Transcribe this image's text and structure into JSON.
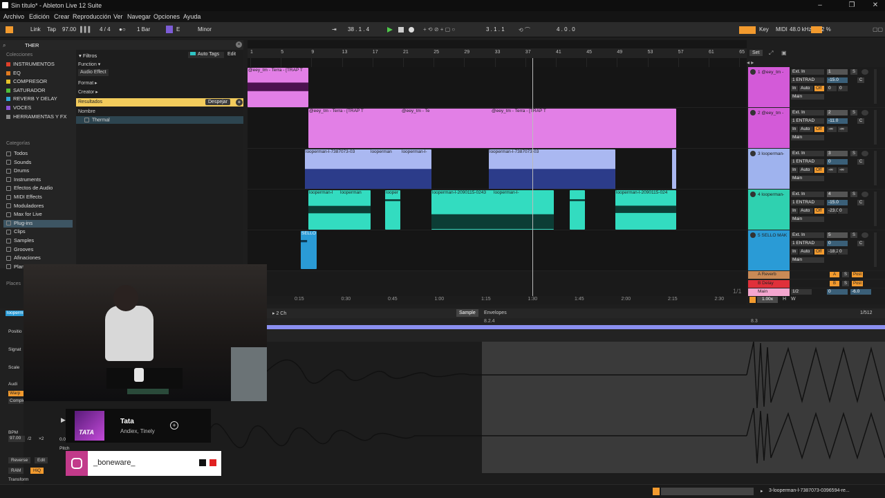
{
  "window": {
    "title": "Sin título* - Ableton Live 12 Suite"
  },
  "menu": [
    "Archivo",
    "Edición",
    "Crear",
    "Reproducción",
    "Ver",
    "Navegar",
    "Opciones",
    "Ayuda"
  ],
  "transport": {
    "link": "Link",
    "tap": "Tap",
    "tempo": "97.00",
    "signature": "4 / 4",
    "quantize": "1 Bar",
    "key": "E",
    "scale": "Minor",
    "position": "38 . 1 . 4",
    "loop_start": "3 . 1 . 1",
    "loop_length": "4 . 0 . 0",
    "key_btn": "Key",
    "midi_btn": "MIDI",
    "sample_rate": "48.0 kHz",
    "cpu": "2 %"
  },
  "browser": {
    "search": "THER",
    "filters_label": "Filtros",
    "auto_tags": "Auto Tags",
    "edit": "Edit",
    "function_label": "Function",
    "function_value": "Audio Effect",
    "format_label": "Format",
    "creator_label": "Creator",
    "results_label": "Resultados",
    "clear_btn": "Despejar",
    "name_col": "Nombre",
    "result_item": "Thermal",
    "collections_header": "Colecciones",
    "collections": [
      {
        "label": "INSTRUMENTOS",
        "color": "#e0402a"
      },
      {
        "label": "EQ",
        "color": "#e07a1f"
      },
      {
        "label": "COMPRESOR",
        "color": "#e6c229"
      },
      {
        "label": "SATURADOR",
        "color": "#4fbf3a"
      },
      {
        "label": "REVERB Y DELAY",
        "color": "#2fa7d8"
      },
      {
        "label": "VOCES",
        "color": "#8a53d6"
      },
      {
        "label": "HERRAMIENTAS Y FX",
        "color": "#8a8a8a"
      }
    ],
    "categories_header": "Categorías",
    "categories": [
      "Todos",
      "Sounds",
      "Drums",
      "Instruments",
      "Efectos de Audio",
      "MIDI Effects",
      "Moduladores",
      "Max for Live",
      "Plug-ins",
      "Clips",
      "Samples",
      "Grooves",
      "Afinaciones",
      "Plantillas"
    ],
    "places_header": "Places"
  },
  "ruler_bars": [
    "1",
    "5",
    "9",
    "13",
    "17",
    "21",
    "25",
    "29",
    "33",
    "37",
    "41",
    "45",
    "49",
    "53",
    "57",
    "61",
    "65"
  ],
  "set_label": "Set",
  "timeline": [
    "0:15",
    "0:30",
    "0:45",
    "1:00",
    "1:15",
    "1:30",
    "1:45",
    "2:00",
    "2:15",
    "2:30"
  ],
  "page_indicator": "1/1",
  "tracks": [
    {
      "name": "1 @eey_tm -",
      "color": "#d35ad8",
      "input": "Ext. In",
      "channel": "1 ENTRAD",
      "in_btn": "In",
      "auto_btn": "Auto",
      "off_btn": "Off",
      "out": "Main",
      "num": "1",
      "vol": "-15.0",
      "pan": "C",
      "send_a": "0",
      "send_b": "0"
    },
    {
      "name": "2 @eey_tm -",
      "color": "#d35ad8",
      "input": "Ext. In",
      "channel": "1 ENTRAD",
      "in_btn": "In",
      "auto_btn": "Auto",
      "off_btn": "Off",
      "out": "Main",
      "num": "2",
      "vol": "-11.0",
      "pan": "C",
      "send_a": "-∞",
      "send_b": "-∞"
    },
    {
      "name": "3 looperman-",
      "color": "#9fb3ee",
      "input": "Ext. In",
      "channel": "1 ENTRAD",
      "in_btn": "In",
      "auto_btn": "Auto",
      "off_btn": "Off",
      "out": "Main",
      "num": "3",
      "vol": "0",
      "pan": "C",
      "send_a": "-∞",
      "send_b": "-∞"
    },
    {
      "name": "4 looperman-",
      "color": "#2fd1b0",
      "input": "Ext. In",
      "channel": "1 ENTRAD",
      "in_btn": "In",
      "auto_btn": "Auto",
      "off_btn": "Off",
      "out": "Main",
      "num": "4",
      "vol": "-15.0",
      "pan": "C",
      "send_a": "-23.0",
      "send_b": "0"
    },
    {
      "name": "5 SELLO MAK",
      "color": "#2a9bd6",
      "input": "Ext. In",
      "channel": "1 ENTRAD",
      "in_btn": "In",
      "auto_btn": "Auto",
      "off_btn": "Off",
      "out": "Main",
      "num": "5",
      "vol": "0",
      "pan": "C",
      "send_a": "-18.2",
      "send_b": "0"
    }
  ],
  "returns": [
    {
      "name": "A Reverb",
      "color": "#c98a56",
      "letter": "A",
      "post": "Post"
    },
    {
      "name": "B Delay",
      "color": "#e0303a",
      "letter": "B",
      "post": "Post"
    },
    {
      "name": "Main",
      "color": "#f4a6cf",
      "fraction": "1/2",
      "vol": "0",
      "vol2": "-6.0"
    }
  ],
  "clip_labels": {
    "t1": "@eey_tm - Terra - [TRAP T",
    "t2": "@eey_tm - Terra - [TRAP T",
    "t2b": "@eey_tm - Te",
    "t2c": "@eey_tm - Terra - [TRAP T",
    "t3": "looperman-l-7387073-03",
    "t3b": "looperman",
    "t3c": "looperman-l-",
    "t3d": "looperman-l-7387073-03",
    "t4": "looperman-l",
    "t4b": "looperman",
    "t4c": "looper",
    "t4d": "looperman-l-2090115-0243",
    "t4e": "looperman-l-",
    "t4f": "looperman-l-2090115-024",
    "t5": "SELLO"
  },
  "zoom": "1.00x",
  "detail": {
    "tab_sample": "Sample",
    "tab_envelopes": "Envelopes",
    "channels": "2 Ch",
    "page": "1/512",
    "marker1": "8.2.4",
    "marker2": "8.3",
    "clip_name": "looperm",
    "position": "Positio",
    "signature": "Signat",
    "scale": "Scale",
    "audio": "Audi",
    "warp": "Warp",
    "complex": "Comple",
    "bpm_label": "BPM",
    "bpm": "97.00",
    "half": "/2",
    "double": "×2",
    "seventy": "70",
    "db": "0.0 dB",
    "pitch": "Pitch",
    "reverse": "Reverse",
    "edit": "Edit",
    "ram": "RAM",
    "hiq": "HiQ",
    "transform": "Transform"
  },
  "song": {
    "title": "Tata",
    "artists": "Andiex, Tinely",
    "art_text": "TATA"
  },
  "instagram": {
    "handle": "_boneware_"
  },
  "status": {
    "file": "3-looperman-l-7387073-0396594-re..."
  }
}
